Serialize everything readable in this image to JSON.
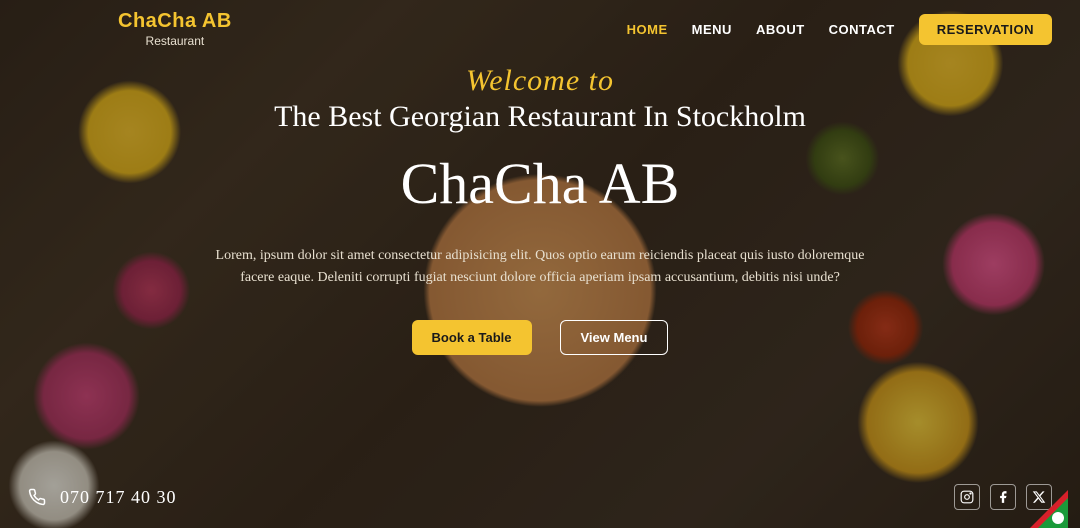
{
  "brand": {
    "title": "ChaCha AB",
    "subtitle": "Restaurant"
  },
  "nav": {
    "items": [
      {
        "label": "HOME",
        "active": true
      },
      {
        "label": "MENU",
        "active": false
      },
      {
        "label": "ABOUT",
        "active": false
      },
      {
        "label": "CONTACT",
        "active": false
      }
    ],
    "reservation_label": "RESERVATION"
  },
  "hero": {
    "welcome": "Welcome to",
    "tagline": "The Best Georgian Restaurant In Stockholm",
    "title": "ChaCha AB",
    "description": "Lorem, ipsum dolor sit amet consectetur adipisicing elit. Quos optio earum reiciendis placeat quis iusto doloremque facere eaque. Deleniti corrupti fugiat nesciunt dolore officia aperiam ipsam accusantium, debitis nisi unde?",
    "cta_primary": "Book a Table",
    "cta_secondary": "View Menu"
  },
  "footer": {
    "phone": "070 717 40 30",
    "socials": [
      {
        "name": "instagram"
      },
      {
        "name": "facebook"
      },
      {
        "name": "x-twitter"
      }
    ]
  }
}
